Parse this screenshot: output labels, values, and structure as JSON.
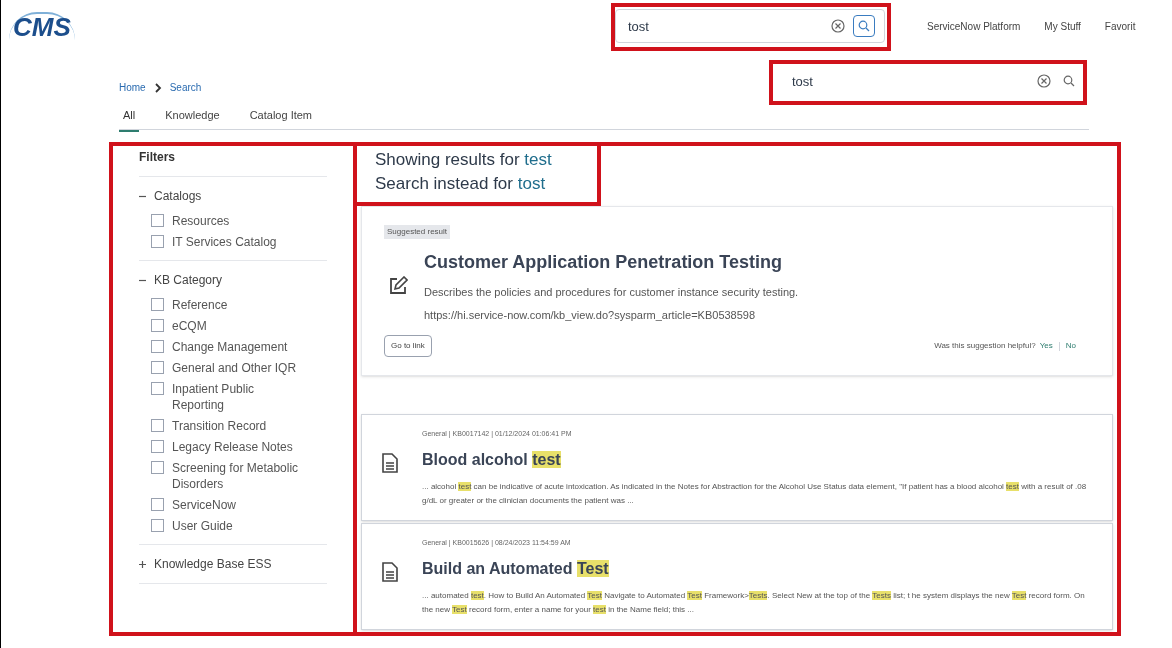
{
  "header": {
    "logo": "CMS",
    "search": {
      "value": "tost"
    },
    "links": [
      "ServiceNow Platform",
      "My Stuff",
      "Favorit"
    ]
  },
  "breadcrumb": [
    "Home",
    "Search"
  ],
  "tabs": [
    {
      "label": "All",
      "selected": true
    },
    {
      "label": "Knowledge",
      "selected": false
    },
    {
      "label": "Catalog Item",
      "selected": false
    }
  ],
  "page_search": {
    "value": "tost"
  },
  "filters": {
    "title": "Filters",
    "groups": [
      {
        "label": "Catalogs",
        "expanded": true,
        "items": [
          {
            "label": "Resources",
            "checked": false
          },
          {
            "label": "IT Services Catalog",
            "checked": false
          }
        ]
      },
      {
        "label": "KB Category",
        "expanded": true,
        "items": [
          {
            "label": "Reference",
            "checked": false
          },
          {
            "label": "eCQM",
            "checked": false
          },
          {
            "label": "Change Management",
            "checked": false
          },
          {
            "label": "General and Other IQR",
            "checked": false
          },
          {
            "label": "Inpatient Public Reporting",
            "checked": false
          },
          {
            "label": "Transition Record",
            "checked": false
          },
          {
            "label": "Legacy Release Notes",
            "checked": false
          },
          {
            "label": "Screening for Metabolic Disorders",
            "checked": false
          },
          {
            "label": "ServiceNow",
            "checked": false
          },
          {
            "label": "User Guide",
            "checked": false
          }
        ]
      },
      {
        "label": "Knowledge Base ESS",
        "expanded": false
      }
    ]
  },
  "spelling": {
    "showing_prefix": "Showing results for",
    "showing_term": "test",
    "instead_prefix": "Search instead for",
    "instead_term": "tost"
  },
  "suggested": {
    "badge": "Suggested result",
    "title": "Customer Application Penetration Testing",
    "description": "Describes the policies and procedures for customer instance security testing.",
    "url": "https://hi.service-now.com/kb_view.do?sysparm_article=KB0538598",
    "button": "Go to link",
    "feedback": "Was this suggestion helpful?",
    "yes": "Yes",
    "no": "No"
  },
  "results": [
    {
      "meta": "General | KB0017142 | 01/12/2024 01:06:41 PM",
      "title": [
        {
          "text": "Blood alcohol ",
          "highlight": false
        },
        {
          "text": "test",
          "highlight": true
        }
      ],
      "snippet": [
        {
          "text": "... alcohol ",
          "highlight": false
        },
        {
          "text": "test",
          "highlight": true
        },
        {
          "text": " can be indicative of acute intoxication. As indicated in the Notes for Abstraction for the Alcohol Use Status data element, \"If patient has a blood alcohol ",
          "highlight": false
        },
        {
          "text": "test",
          "highlight": true
        },
        {
          "text": " with a result of .08 g/dL or greater or the clinician documents the patient was ...",
          "highlight": false
        }
      ]
    },
    {
      "meta": "General | KB0015626 | 08/24/2023 11:54:59 AM",
      "title": [
        {
          "text": "Build an Automated ",
          "highlight": false
        },
        {
          "text": "Test",
          "highlight": true
        }
      ],
      "snippet": [
        {
          "text": "... automated ",
          "highlight": false
        },
        {
          "text": "test",
          "highlight": true
        },
        {
          "text": ". How to Build An Automated ",
          "highlight": false
        },
        {
          "text": "Test",
          "highlight": true
        },
        {
          "text": " Navigate to Automated ",
          "highlight": false
        },
        {
          "text": "Test",
          "highlight": true
        },
        {
          "text": " Framework>",
          "highlight": false
        },
        {
          "text": "Tests",
          "highlight": true
        },
        {
          "text": ". Select New at the top of the ",
          "highlight": false
        },
        {
          "text": "Tests",
          "highlight": true
        },
        {
          "text": " list; t he system displays the new ",
          "highlight": false
        },
        {
          "text": "Test",
          "highlight": true
        },
        {
          "text": " record form. On the new ",
          "highlight": false
        },
        {
          "text": "Test",
          "highlight": true
        },
        {
          "text": " record form, enter a name for your ",
          "highlight": false
        },
        {
          "text": "test",
          "highlight": true
        },
        {
          "text": " in the Name field; this ...",
          "highlight": false
        }
      ]
    }
  ]
}
